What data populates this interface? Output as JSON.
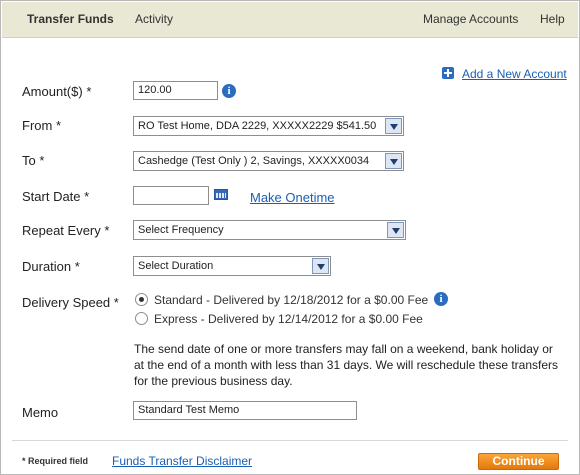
{
  "nav": {
    "transfer_funds": "Transfer Funds",
    "activity": "Activity",
    "manage_accounts": "Manage Accounts",
    "help": "Help"
  },
  "add_account_link": "Add a New Account",
  "form": {
    "amount": {
      "label": "Amount($)",
      "required": "*",
      "value": "120.00"
    },
    "from": {
      "label": "From",
      "required": "*",
      "value": "RO Test Home, DDA 2229, XXXXX2229 $541.50"
    },
    "to": {
      "label": "To",
      "required": "*",
      "value": "Cashedge (Test Only ) 2, Savings, XXXXX0034"
    },
    "start_date": {
      "label": "Start Date",
      "required": "*",
      "value": "",
      "make_onetime": "Make Onetime"
    },
    "repeat_every": {
      "label": "Repeat Every",
      "required": "*",
      "value": "Select Frequency"
    },
    "duration": {
      "label": "Duration",
      "required": "*",
      "value": "Select Duration"
    },
    "delivery_speed": {
      "label": "Delivery Speed",
      "required": "*",
      "options": [
        {
          "label": "Standard - Delivered by 12/18/2012 for a $0.00 Fee",
          "checked": true
        },
        {
          "label": "Express - Delivered by 12/14/2012 for a $0.00 Fee",
          "checked": false
        }
      ]
    },
    "note": "The send date of one or more transfers may fall on a weekend, bank holiday or at the end of a month with less than 31 days. We will reschedule these transfers for the previous business day.",
    "memo": {
      "label": "Memo",
      "value": "Standard Test Memo"
    }
  },
  "footer": {
    "required_note": "* Required field",
    "disclaimer_link": "Funds Transfer Disclaimer",
    "continue_button": "Continue"
  },
  "icons": {
    "info": "info-icon",
    "add": "plus-icon",
    "calendar": "calendar-icon",
    "dropdown": "chevron-down-icon"
  },
  "colors": {
    "nav_background": "#e8e8d4",
    "link": "#1a5fb4",
    "continue_button": "#f08a1c",
    "info_icon": "#2a6cc0"
  }
}
